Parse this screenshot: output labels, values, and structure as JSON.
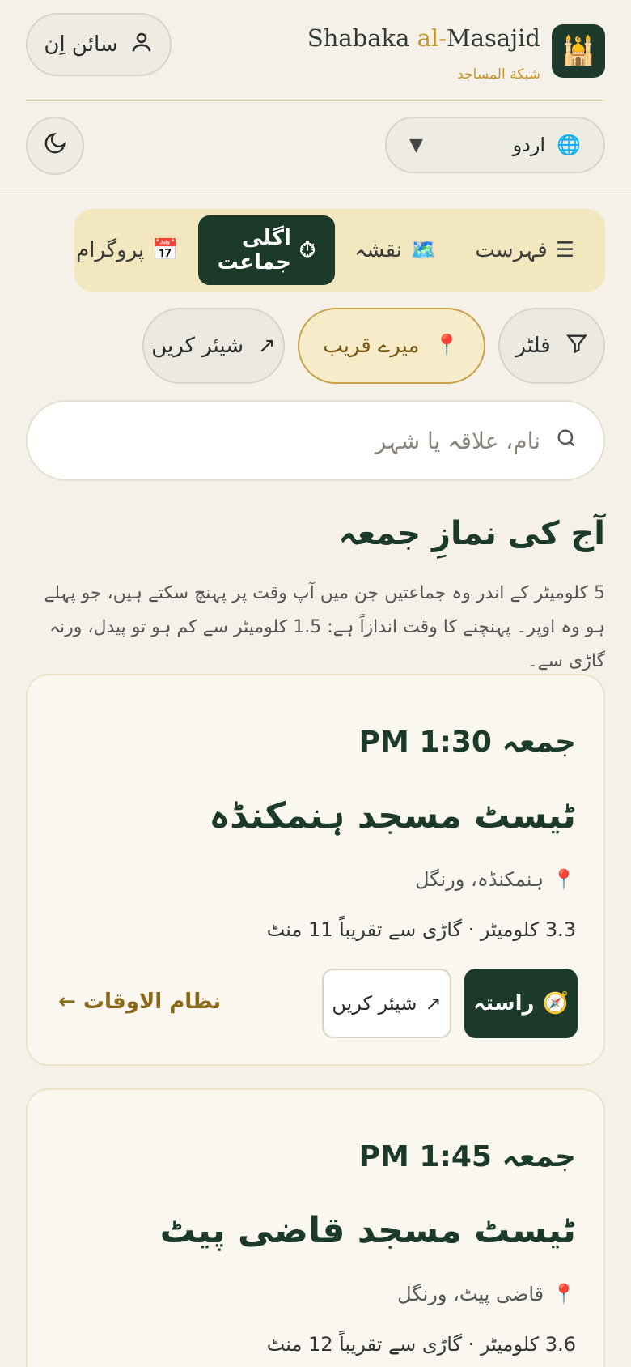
{
  "header": {
    "signin_label": "سائن اِن",
    "brand_prefix": "Shabaka ",
    "brand_accent": "al-",
    "brand_suffix": "Masajid",
    "brand_sub": "شبکة المساجد",
    "logo_icon": "mosque-icon",
    "language_selected": "اردو",
    "language_icon": "globe-icon",
    "theme_icon": "moon-icon"
  },
  "tabs": [
    {
      "label": "فہرست",
      "icon": "list-icon"
    },
    {
      "label": "نقشہ",
      "icon": "map-icon"
    },
    {
      "label": "اگلی جماعت",
      "icon": "clock-icon",
      "active": true
    },
    {
      "label": "پروگرام",
      "icon": "calendar-icon"
    }
  ],
  "chips": {
    "filter": "فلٹر",
    "near": "میرے قریب",
    "share": "شیئر کریں"
  },
  "search": {
    "placeholder": "نام، علاقہ یا شہر"
  },
  "section": {
    "title": "آج کی نمازِ جمعہ",
    "description": "5 کلومیٹر کے اندر وہ جماعتیں جن میں آپ وقت پر پہنچ سکتے ہیں، جو پہلے ہو وہ اوپر۔ پہنچنے کا وقت اندازاً ہے: 1.5 کلومیٹر سے کم ہو تو پیدل، ورنہ گاڑی سے۔"
  },
  "cards": [
    {
      "time": "جمعہ 1:30 PM",
      "name": "ٹیسٹ مسجد ہنمکنڈہ",
      "location": "ہنمکنڈہ، ورنگل",
      "distance": "3.3 کلومیٹر · گاڑی سے تقریباً 11 منٹ",
      "directions": "راستہ",
      "share": "شیئر کریں",
      "schedule": "نظام الاوقات ←"
    },
    {
      "time": "جمعہ 1:45 PM",
      "name": "ٹیسٹ مسجد قاضی پیٹ",
      "location": "قاضی پیٹ، ورنگل",
      "distance": "3.6 کلومیٹر · گاڑی سے تقریباً 12 منٹ"
    }
  ],
  "colors": {
    "accent_dark": "#1c3a2a",
    "accent_gold": "#c6962a",
    "background": "#f5f1e8"
  }
}
